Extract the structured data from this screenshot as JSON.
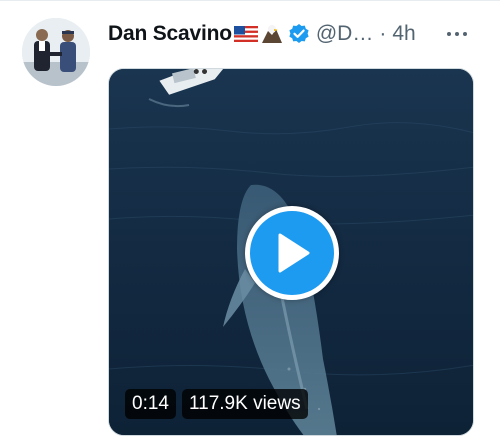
{
  "tweet": {
    "display_name": "Dan Scavino",
    "name_emojis": [
      "flag-usa-icon",
      "eagle-icon"
    ],
    "handle": "@D…",
    "separator": "·",
    "time": "4h",
    "verified": true,
    "more_icon": "more-horizontal-icon",
    "video": {
      "duration": "0:14",
      "views": "117.9K views",
      "play_icon": "play-icon"
    }
  },
  "colors": {
    "accent": "#1d9bf0",
    "text_primary": "#0f1419",
    "text_secondary": "#536471"
  }
}
